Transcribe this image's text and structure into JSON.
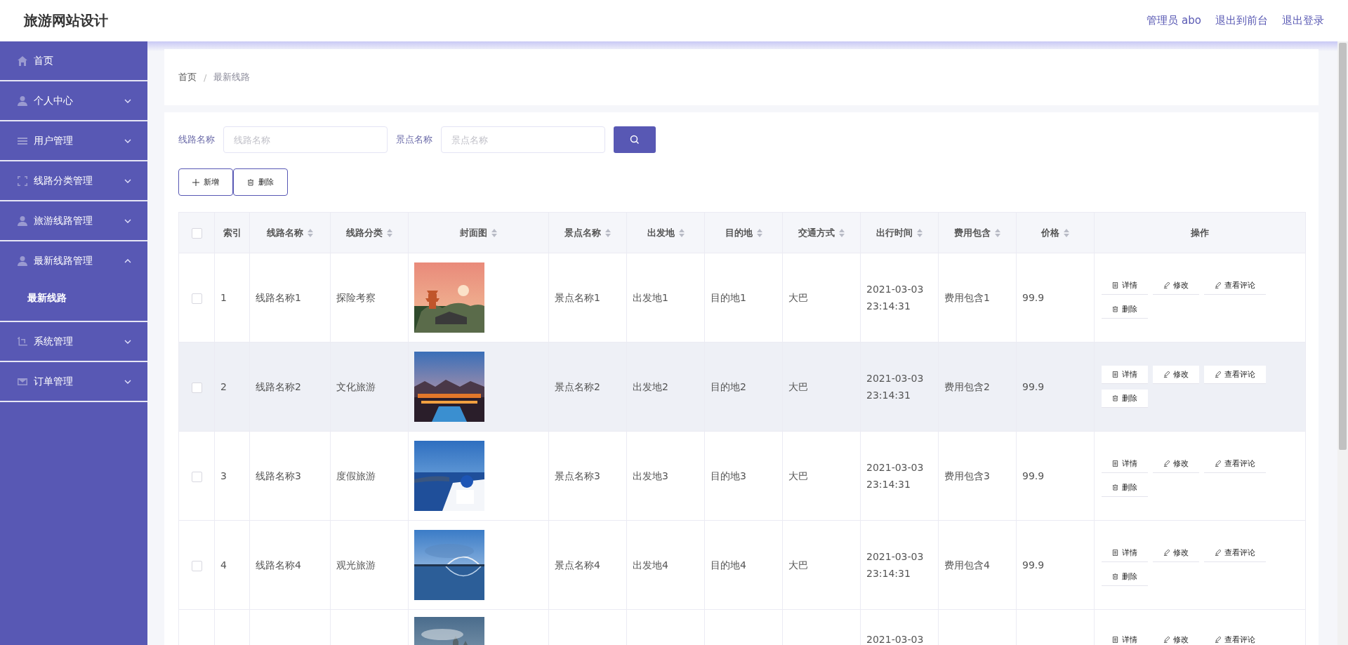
{
  "header": {
    "title": "旅游网站设计",
    "links": [
      "管理员 abo",
      "退出到前台",
      "退出登录"
    ]
  },
  "sidebar": {
    "items": [
      {
        "label": "首页",
        "kind": "link",
        "expanded": false
      },
      {
        "label": "个人中心",
        "kind": "menu",
        "expanded": false
      },
      {
        "label": "用户管理",
        "kind": "menu",
        "expanded": false
      },
      {
        "label": "线路分类管理",
        "kind": "menu",
        "expanded": false
      },
      {
        "label": "旅游线路管理",
        "kind": "menu",
        "expanded": false
      },
      {
        "label": "最新线路管理",
        "kind": "menu",
        "expanded": true,
        "children": [
          {
            "label": "最新线路",
            "selected": true
          }
        ]
      },
      {
        "label": "系统管理",
        "kind": "menu",
        "expanded": false
      },
      {
        "label": "订单管理",
        "kind": "menu",
        "expanded": false
      }
    ]
  },
  "breadcrumb": [
    "首页",
    "最新线路"
  ],
  "breadcrumb_separator": "/",
  "search": {
    "fields": [
      {
        "label": "线路名称",
        "placeholder": "线路名称"
      },
      {
        "label": "景点名称",
        "placeholder": "景点名称"
      }
    ]
  },
  "toolbar": [
    {
      "label": "新增",
      "kind": "add"
    },
    {
      "label": "删除",
      "kind": "delete"
    }
  ],
  "table": {
    "header_checked": false,
    "columns": [
      {
        "label": "索引",
        "kind": "plain"
      },
      {
        "label": "线路名称",
        "kind": "sortable"
      },
      {
        "label": "线路分类",
        "kind": "sortable"
      },
      {
        "label": "封面图",
        "kind": "sortable"
      },
      {
        "label": "景点名称",
        "kind": "sortable"
      },
      {
        "label": "出发地",
        "kind": "sortable"
      },
      {
        "label": "目的地",
        "kind": "sortable"
      },
      {
        "label": "交通方式",
        "kind": "sortable"
      },
      {
        "label": "出行时间",
        "kind": "sortable"
      },
      {
        "label": "费用包含",
        "kind": "sortable"
      },
      {
        "label": "价格",
        "kind": "sortable"
      },
      {
        "label": "操作",
        "kind": "plain"
      }
    ],
    "rows": [
      {
        "selected": false,
        "highlighted": false,
        "cells": [
          "1",
          "线路名称1",
          "探险考察",
          null,
          "景点名称1",
          "出发地1",
          "目的地1",
          "大巴",
          "2021-03-03 23:14:31",
          "费用包含1",
          "99.9"
        ],
        "actions": [
          {
            "label": "详情",
            "kind": "detail"
          },
          {
            "label": "修改",
            "kind": "edit"
          },
          {
            "label": "查看评论",
            "kind": "edit"
          },
          {
            "label": "删除",
            "kind": "delete"
          }
        ]
      },
      {
        "selected": false,
        "highlighted": true,
        "cells": [
          "2",
          "线路名称2",
          "文化旅游",
          null,
          "景点名称2",
          "出发地2",
          "目的地2",
          "大巴",
          "2021-03-03 23:14:31",
          "费用包含2",
          "99.9"
        ],
        "actions": [
          {
            "label": "详情",
            "kind": "detail"
          },
          {
            "label": "修改",
            "kind": "edit"
          },
          {
            "label": "查看评论",
            "kind": "edit"
          },
          {
            "label": "删除",
            "kind": "delete"
          }
        ]
      },
      {
        "selected": false,
        "highlighted": false,
        "cells": [
          "3",
          "线路名称3",
          "度假旅游",
          null,
          "景点名称3",
          "出发地3",
          "目的地3",
          "大巴",
          "2021-03-03 23:14:31",
          "费用包含3",
          "99.9"
        ],
        "actions": [
          {
            "label": "详情",
            "kind": "detail"
          },
          {
            "label": "修改",
            "kind": "edit"
          },
          {
            "label": "查看评论",
            "kind": "edit"
          },
          {
            "label": "删除",
            "kind": "delete"
          }
        ]
      },
      {
        "selected": false,
        "highlighted": false,
        "cells": [
          "4",
          "线路名称4",
          "观光旅游",
          null,
          "景点名称4",
          "出发地4",
          "目的地4",
          "大巴",
          "2021-03-03 23:14:31",
          "费用包含4",
          "99.9"
        ],
        "actions": [
          {
            "label": "详情",
            "kind": "detail"
          },
          {
            "label": "修改",
            "kind": "edit"
          },
          {
            "label": "查看评论",
            "kind": "edit"
          },
          {
            "label": "删除",
            "kind": "delete"
          }
        ]
      },
      {
        "highlighted": false,
        "cells": [
          null,
          null,
          null,
          null,
          null,
          null,
          null,
          null,
          "2021-03-03",
          null,
          null
        ],
        "actions": [
          {
            "label": "详情",
            "kind": "detail"
          },
          {
            "label": "修改",
            "kind": "edit"
          },
          {
            "label": "查看评论",
            "kind": "edit"
          }
        ]
      }
    ]
  }
}
